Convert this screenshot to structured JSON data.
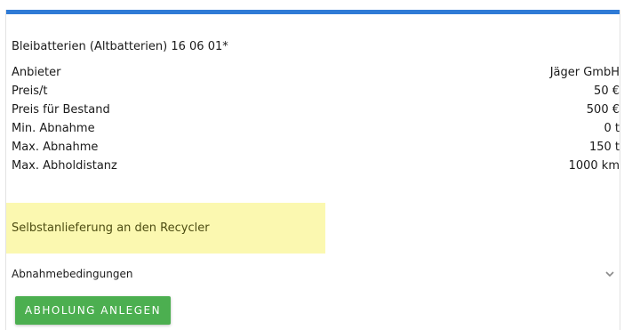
{
  "card": {
    "title": "Bleibatterien (Altbatterien) 16 06 01*",
    "accent_color": "#2f7bd6",
    "rows": [
      {
        "label": "Anbieter",
        "value": "Jäger GmbH"
      },
      {
        "label": "Preis/t",
        "value": "50 €"
      },
      {
        "label": "Preis für Bestand",
        "value": "500 €"
      },
      {
        "label": "Min. Abnahme",
        "value": "0 t"
      },
      {
        "label": "Max. Abnahme",
        "value": "150 t"
      },
      {
        "label": "Max. Abholdistanz",
        "value": "1000 km"
      }
    ],
    "notice": "Selbstanlieferung an den Recycler",
    "notice_color": "#fbf8b0",
    "conditions_label": "Abnahmebedingungen",
    "conditions_icon": "chevron-down-icon",
    "button_label": "ABHOLUNG ANLEGEN",
    "button_color": "#4caf50"
  }
}
